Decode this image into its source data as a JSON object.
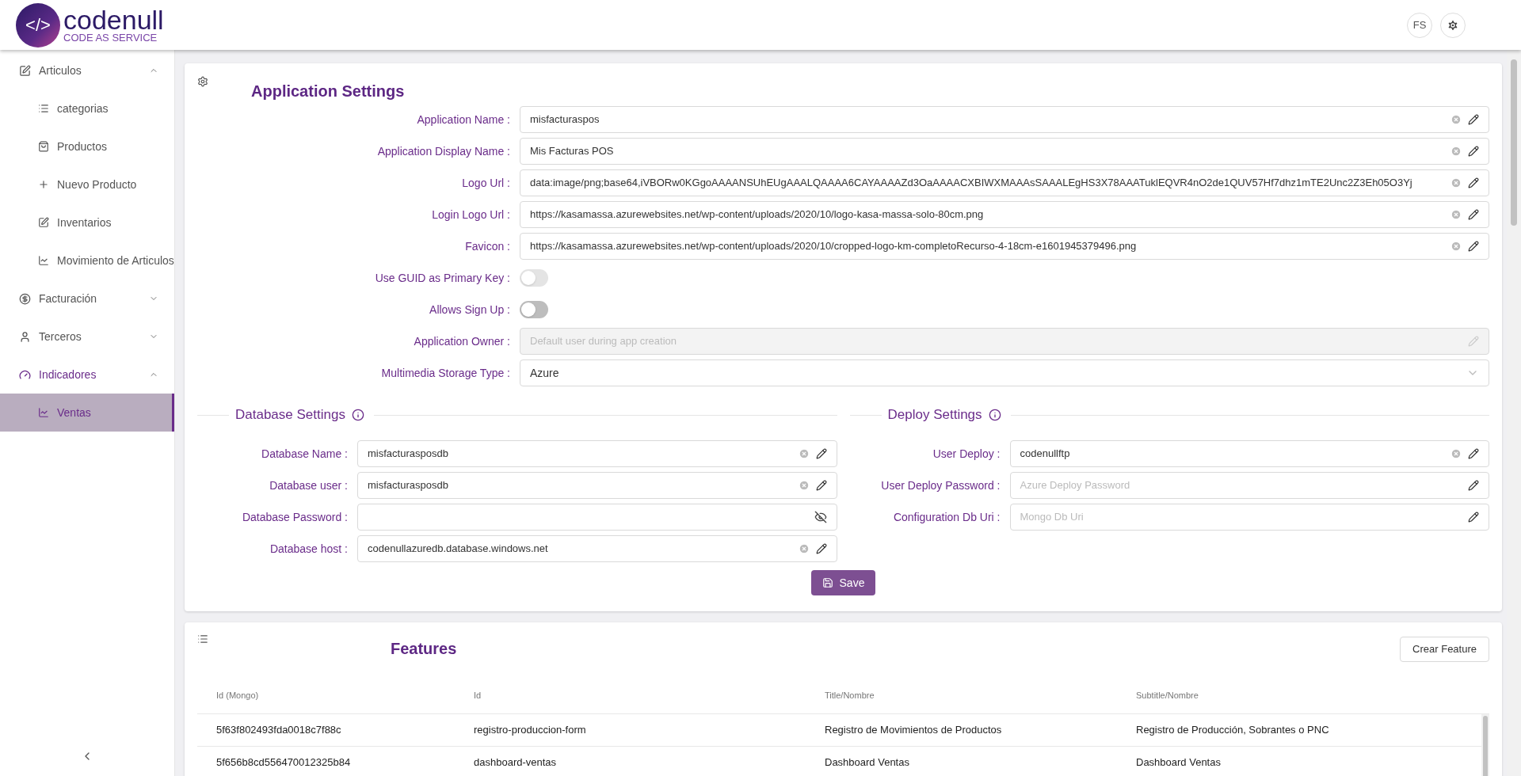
{
  "header": {
    "logo": {
      "mark": "</>",
      "name": "codenull",
      "tagline": "CODE AS SERVICE"
    },
    "user_initials": "FS"
  },
  "sidebar": {
    "items": [
      {
        "label": "Articulos",
        "expanded": true,
        "selected": false,
        "children": [
          {
            "label": "categorias",
            "selected": false
          },
          {
            "label": "Productos",
            "selected": false
          },
          {
            "label": "Nuevo Producto",
            "selected": false
          },
          {
            "label": "Inventarios",
            "selected": false
          },
          {
            "label": "Movimiento de Articulos",
            "selected": false
          }
        ]
      },
      {
        "label": "Facturación",
        "expanded": false,
        "selected": false
      },
      {
        "label": "Terceros",
        "expanded": false,
        "selected": false
      },
      {
        "label": "Indicadores",
        "expanded": true,
        "selected": true,
        "children": [
          {
            "label": "Ventas",
            "selected": true
          }
        ]
      }
    ]
  },
  "app_settings": {
    "title": "Application Settings",
    "fields": [
      {
        "kind": "text",
        "label": "Application Name :",
        "value": "misfacturaspos"
      },
      {
        "kind": "text",
        "label": "Application Display Name :",
        "value": "Mis Facturas POS"
      },
      {
        "kind": "text",
        "label": "Logo Url :",
        "value": "data:image/png;base64,iVBORw0KGgoAAAANSUhEUgAAALQAAAA6CAYAAAAZd3OaAAAACXBIWXMAAAsSAAALEgHS3X78AAATuklEQVR4nO2de1QUV57Hf7dhz1mTE2Unc2Z3Eh05O3Yj"
      },
      {
        "kind": "text",
        "label": "Login Logo Url :",
        "value": "https://kasamassa.azurewebsites.net/wp-content/uploads/2020/10/logo-kasa-massa-solo-80cm.png"
      },
      {
        "kind": "text",
        "label": "Favicon :",
        "value": "https://kasamassa.azurewebsites.net/wp-content/uploads/2020/10/cropped-logo-km-completoRecurso-4-18cm-e1601945379496.png"
      },
      {
        "kind": "switch",
        "label": "Use GUID as Primary Key :",
        "on": false,
        "disabled": true
      },
      {
        "kind": "switch",
        "label": "Allows Sign Up :",
        "on": false,
        "disabled": false
      },
      {
        "kind": "text",
        "label": "Application Owner :",
        "placeholder": "Default user during app creation",
        "disabled": true
      },
      {
        "kind": "select",
        "label": "Multimedia Storage Type :",
        "value": "Azure"
      }
    ]
  },
  "database_settings": {
    "title": "Database Settings",
    "fields": [
      {
        "kind": "text",
        "label": "Database Name :",
        "value": "misfacturasposdb"
      },
      {
        "kind": "text",
        "label": "Database user :",
        "value": "misfacturasposdb"
      },
      {
        "kind": "password",
        "label": "Database Password :"
      },
      {
        "kind": "text",
        "label": "Database host :",
        "value": "codenullazuredb.database.windows.net"
      }
    ]
  },
  "deploy_settings": {
    "title": "Deploy Settings",
    "fields": [
      {
        "kind": "text",
        "label": "User Deploy :",
        "value": "codenullftp"
      },
      {
        "kind": "text",
        "label": "User Deploy Password :",
        "placeholder": "Azure Deploy Password"
      },
      {
        "kind": "text",
        "label": "Configuration Db Uri :",
        "placeholder": "Mongo Db Uri"
      }
    ]
  },
  "save_button": "Save",
  "features": {
    "title": "Features",
    "create_button": "Crear Feature",
    "columns": [
      "Id (Mongo)",
      "Id",
      "Title/Nombre",
      "Subtitle/Nombre"
    ],
    "rows": [
      [
        "5f63f802493fda0018c7f88c",
        "registro-produccion-form",
        "Registro de Movimientos de Productos",
        "Registro de Producción, Sobrantes o PNC"
      ],
      [
        "5f656b8cd556470012325b84",
        "dashboard-ventas",
        "Dashboard Ventas",
        "Dashboard Ventas"
      ]
    ]
  }
}
